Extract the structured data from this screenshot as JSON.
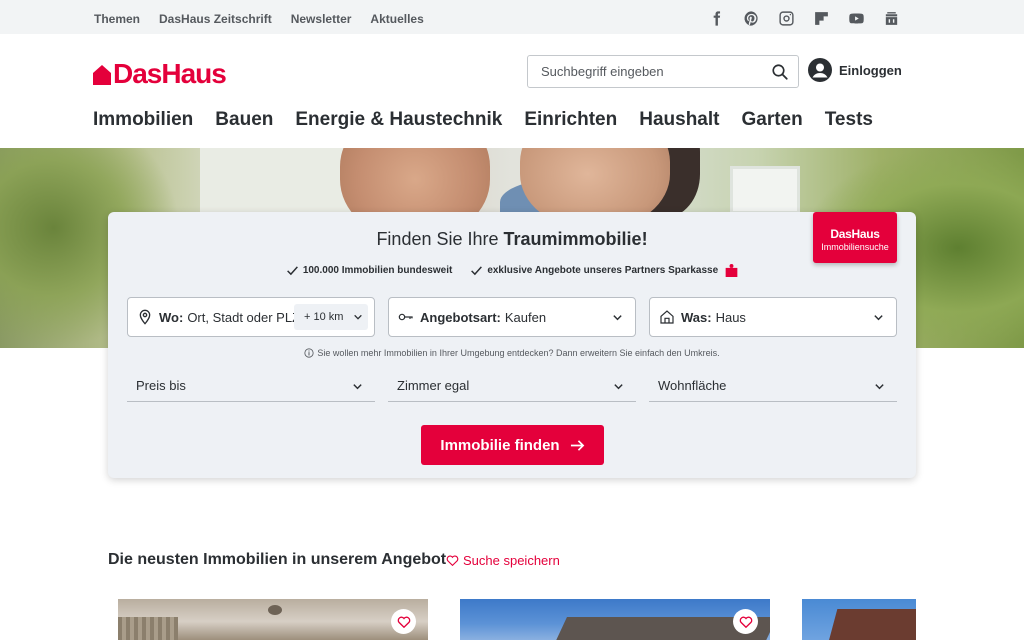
{
  "topbar": {
    "links": [
      "Themen",
      "DasHaus Zeitschrift",
      "Newsletter",
      "Aktuelles"
    ],
    "social_icons": [
      "facebook-icon",
      "pinterest-icon",
      "instagram-icon",
      "flipboard-icon",
      "youtube-icon",
      "podcast-icon"
    ]
  },
  "header": {
    "logo": "DasHaus",
    "search_placeholder": "Suchbegriff eingeben",
    "login_label": "Einloggen"
  },
  "nav": [
    "Immobilien",
    "Bauen",
    "Energie & Haustechnik",
    "Einrichten",
    "Haushalt",
    "Garten",
    "Tests"
  ],
  "search_card": {
    "title_pre": "Finden Sie Ihre",
    "title_bold": "Traumimmobilie!",
    "badge_title": "DasHaus",
    "badge_sub": "Immobiliensuche",
    "check1": "100.000 Immobilien bundesweit",
    "check2": "exklusive Angebote unseres Partners Sparkasse",
    "where_label": "Wo:",
    "where_placeholder": "Ort, Stadt oder PLZ",
    "radius": "+ 10 km",
    "offer_label": "Angebotsart:",
    "offer_value": "Kaufen",
    "what_label": "Was:",
    "what_value": "Haus",
    "hint": "Sie wollen mehr Immobilien in Ihrer Umgebung entdecken? Dann erweitern Sie einfach den Umkreis.",
    "price": "Preis bis",
    "rooms": "Zimmer egal",
    "area": "Wohnfläche",
    "submit": "Immobilie finden"
  },
  "listings": {
    "title": "Die neusten Immobilien in unserem Angebot",
    "save_search": "Suche speichern"
  },
  "colors": {
    "brand": "#e4003b",
    "card_bg": "#eef1f5",
    "text": "#2b2f33"
  }
}
